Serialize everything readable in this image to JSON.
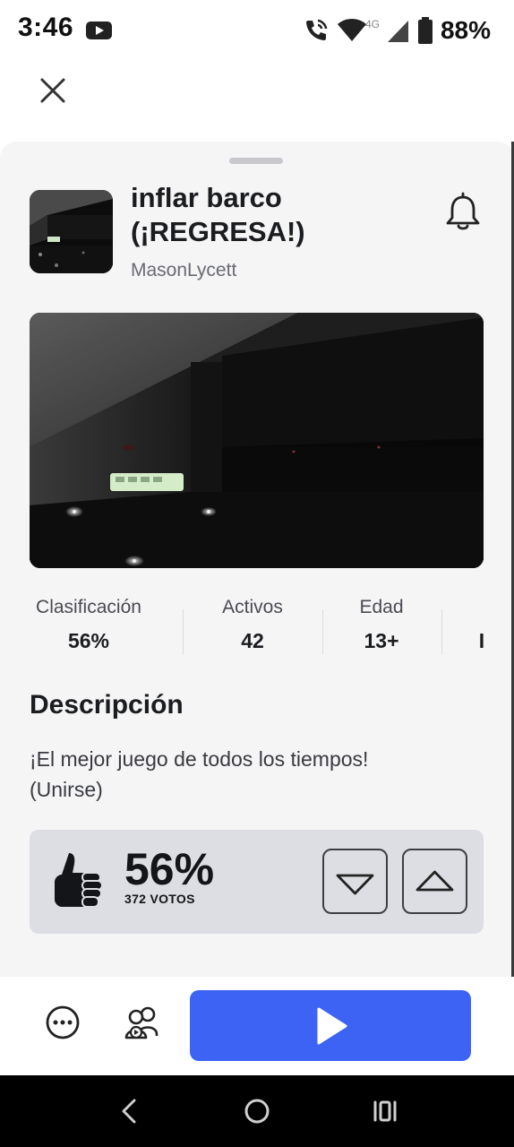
{
  "status_bar": {
    "time": "3:46",
    "network_label": "4G",
    "battery": "88%"
  },
  "game": {
    "title": "inflar barco (¡REGRESA!)",
    "creator": "MasonLycett"
  },
  "stats": [
    {
      "label": "Clasificación",
      "value": "56%"
    },
    {
      "label": "Activos",
      "value": "42"
    },
    {
      "label": "Edad",
      "value": "13+"
    },
    {
      "label": "",
      "value": "I"
    }
  ],
  "description": {
    "heading": "Descripción",
    "text": "¡El mejor juego de todos los tiempos!\n(Unirse)"
  },
  "votes": {
    "percent": "56%",
    "count": "372 VOTOS"
  },
  "colors": {
    "play_button": "#3c63f4",
    "sheet_background": "#f5f5f6",
    "vote_box": "#dddee3"
  },
  "icons": [
    "youtube-icon",
    "wifi-call-icon",
    "wifi-icon",
    "signal-icon",
    "battery-icon",
    "close-icon",
    "bell-icon",
    "thumbs-up-icon",
    "thumb-down-arrow-icon",
    "thumb-up-arrow-icon",
    "more-icon",
    "friends-icon",
    "play-icon",
    "back-icon",
    "home-icon",
    "recents-icon"
  ]
}
